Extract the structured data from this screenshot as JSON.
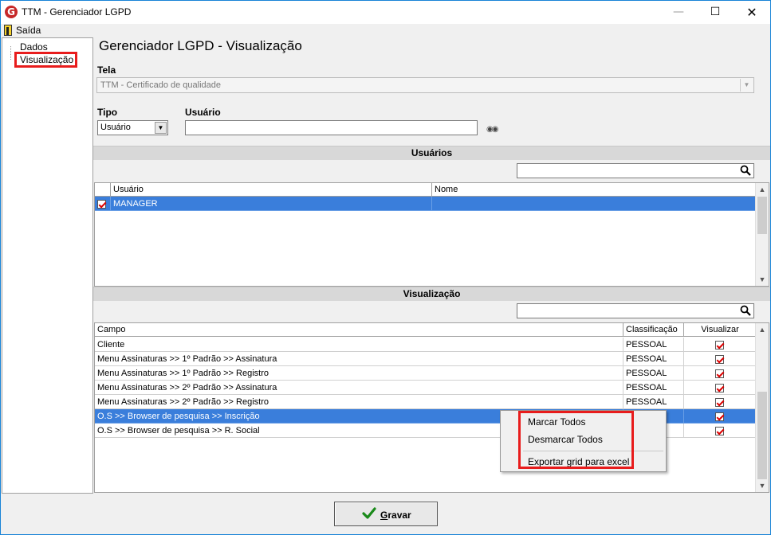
{
  "window": {
    "title": "TTM - Gerenciador LGPD",
    "app_icon": "G"
  },
  "menu": {
    "saida": "Saída"
  },
  "tree": {
    "items": [
      "Dados",
      "Visualização"
    ]
  },
  "page": {
    "title": "Gerenciador LGPD - Visualização"
  },
  "tela": {
    "label": "Tela",
    "value": "TTM - Certificado de qualidade"
  },
  "tipo": {
    "label": "Tipo",
    "value": "Usuário"
  },
  "usuario": {
    "label": "Usuário",
    "value": ""
  },
  "usuarios_section": {
    "title": "Usuários",
    "search_value": "",
    "columns": [
      "Usuário",
      "Nome"
    ],
    "rows": [
      {
        "checked": true,
        "usuario": "MANAGER",
        "nome": ""
      }
    ]
  },
  "visualizacao_section": {
    "title": "Visualização",
    "search_value": "",
    "columns": [
      "Campo",
      "Classificação",
      "Visualizar"
    ],
    "rows": [
      {
        "campo": "Cliente",
        "classificacao": "PESSOAL",
        "visualizar": true
      },
      {
        "campo": "Menu Assinaturas >> 1º Padrão >> Assinatura",
        "classificacao": "PESSOAL",
        "visualizar": true
      },
      {
        "campo": "Menu Assinaturas >> 1º Padrão >> Registro",
        "classificacao": "PESSOAL",
        "visualizar": true
      },
      {
        "campo": "Menu Assinaturas >> 2º Padrão >> Assinatura",
        "classificacao": "PESSOAL",
        "visualizar": true
      },
      {
        "campo": "Menu Assinaturas >> 2º Padrão >> Registro",
        "classificacao": "PESSOAL",
        "visualizar": true
      },
      {
        "campo": "O.S >> Browser de pesquisa >> Inscrição",
        "classificacao": "",
        "visualizar": true
      },
      {
        "campo": "O.S >> Browser de pesquisa >> R. Social",
        "classificacao": "",
        "visualizar": true
      }
    ]
  },
  "context_menu": {
    "items": [
      "Marcar Todos",
      "Desmarcar Todos",
      "Exportar grid para excel"
    ]
  },
  "footer": {
    "gravar_prefix": "G",
    "gravar_rest": "ravar"
  },
  "colors": {
    "selection": "#3a7edb",
    "highlight": "#e81c1c",
    "check": "#1a8a1a"
  }
}
